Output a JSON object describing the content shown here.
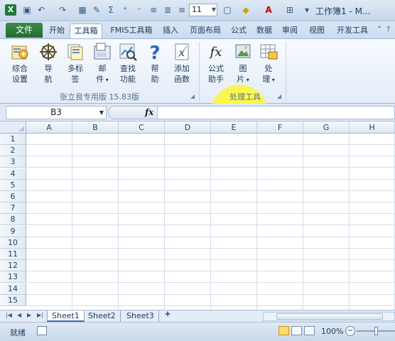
{
  "app": {
    "logo_letter": "X",
    "title": "工作簿1 - M..."
  },
  "qat": {
    "font_size": "11"
  },
  "tabs": [
    {
      "label": "文件"
    },
    {
      "label": "开始"
    },
    {
      "label": "工具箱"
    },
    {
      "label": "FMIS工具箱"
    },
    {
      "label": "插入"
    },
    {
      "label": "页面布局"
    },
    {
      "label": "公式"
    },
    {
      "label": "数据"
    },
    {
      "label": "审阅"
    },
    {
      "label": "视图"
    },
    {
      "label": "开发工具"
    }
  ],
  "ribbon": {
    "group1": {
      "label": "张立良专用版 15.83版",
      "buttons": [
        {
          "line1": "综合",
          "line2": "设置",
          "icon": "settings-icon"
        },
        {
          "line1": "导",
          "line2": "航",
          "icon": "compass-icon"
        },
        {
          "line1": "多标",
          "line2": "签",
          "icon": "multi-tab-icon"
        },
        {
          "line1": "邮",
          "line2": "件",
          "icon": "mail-icon"
        },
        {
          "line1": "查找",
          "line2": "功能",
          "icon": "find-icon"
        },
        {
          "line1": "帮",
          "line2": "助",
          "icon": "help-icon"
        },
        {
          "line1": "添加",
          "line2": "函数",
          "icon": "add-function-icon"
        }
      ]
    },
    "group2": {
      "label": "处理工具",
      "buttons": [
        {
          "line1": "公式",
          "line2": "助手",
          "icon": "fx-icon"
        },
        {
          "line1": "图",
          "line2": "片",
          "icon": "picture-icon"
        },
        {
          "line1": "处",
          "line2": "理",
          "icon": "process-icon"
        }
      ]
    }
  },
  "formula_bar": {
    "name_box": "B3",
    "fx_label": "fx",
    "formula": ""
  },
  "grid": {
    "columns": [
      "A",
      "B",
      "C",
      "D",
      "E",
      "F",
      "G",
      "H"
    ],
    "rows": [
      "1",
      "2",
      "3",
      "4",
      "5",
      "6",
      "7",
      "8",
      "9",
      "10",
      "11",
      "12",
      "13",
      "14",
      "15"
    ]
  },
  "sheets": [
    {
      "label": "Sheet1"
    },
    {
      "label": "Sheet2"
    },
    {
      "label": "Sheet3"
    }
  ],
  "status": {
    "ready": "就绪",
    "zoom": "100%"
  }
}
